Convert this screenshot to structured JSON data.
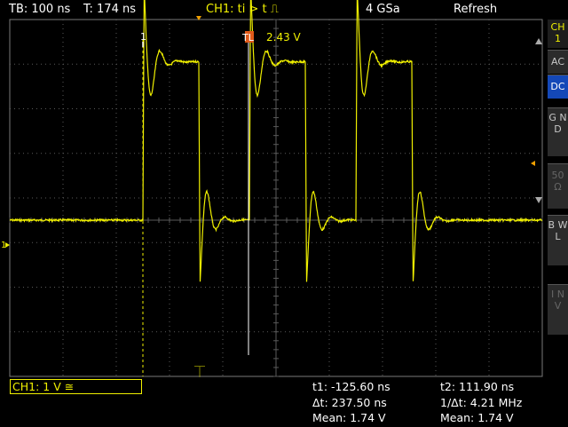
{
  "top": {
    "timebase": "TB: 100 ns",
    "trigger_time": "T: 174 ns",
    "trigger": "CH1: ti > t",
    "trigger_symbol": "⎍",
    "sample_rate": "4 GSa",
    "mode": "Refresh"
  },
  "plot": {
    "trigger_level": "2.43 V",
    "trigger_level_tag": "TL",
    "cursor1_marker": "1",
    "ch_marker": "1"
  },
  "side": {
    "channel_tag": "CH 1",
    "ac": "AC",
    "dc": "DC",
    "gnd": "G N D",
    "ohm": "50 Ω",
    "bwl": "B W L",
    "inv": "I N V"
  },
  "bottom": {
    "ch1_setting": "CH1: 1 V ≅",
    "t1": "t1: -125.60 ns",
    "t2": "t2: 111.90 ns",
    "dt": "Δt: 237.50 ns",
    "inv_dt": "1/Δt: 4.21 MHz",
    "mean1": "Mean: 1.74 V",
    "mean2": "Mean: 1.74 V"
  },
  "colors": {
    "trace": "#f0f000",
    "grid": "#5a5a5a",
    "active": "#1448b8"
  },
  "chart_data": {
    "type": "line",
    "divisions_x": 10,
    "divisions_y": 8,
    "x_unit": "ns/div",
    "x_per_div": 100,
    "y_unit": "V/div",
    "y_per_div": 1,
    "series": [
      {
        "pulses": [
          {
            "rise_div": 2.5,
            "fall_div": 3.55
          },
          {
            "rise_div": 4.5,
            "fall_div": 5.55
          },
          {
            "rise_div": 6.5,
            "fall_div": 7.55
          }
        ],
        "low_level_div": 0,
        "high_level_div": 3.55,
        "overshoot_div": 5.7
      }
    ]
  }
}
